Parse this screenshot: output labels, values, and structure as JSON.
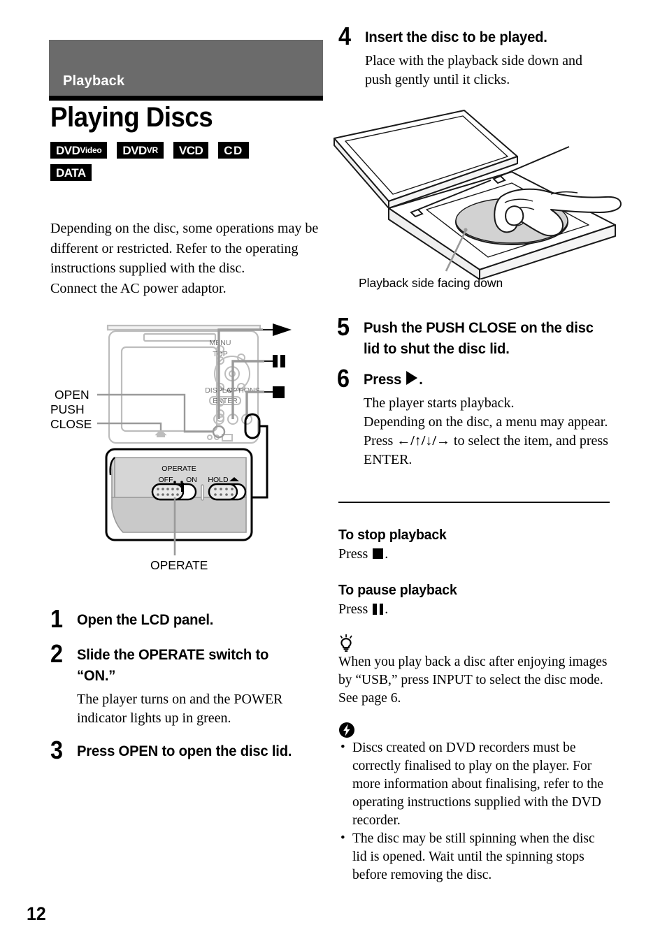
{
  "chapter": {
    "label": "Playback"
  },
  "title": "Playing Discs",
  "badges": [
    [
      {
        "main": "DVD",
        "sub": "Video",
        "name": "dvd-video"
      },
      {
        "main": "DVD",
        "sub": "VR",
        "name": "dvd-vr"
      },
      {
        "main": "VCD",
        "sub": "",
        "name": "vcd"
      },
      {
        "main": "CD",
        "sub": "",
        "name": "cd"
      }
    ],
    [
      {
        "main": "DATA",
        "sub": "",
        "name": "data"
      }
    ]
  ],
  "intro": {
    "p1": "Depending on the disc, some operations may be different or restricted. Refer to the operating instructions supplied with the disc.",
    "p2": "Connect the AC power adaptor."
  },
  "device_diagram": {
    "label_open": "OPEN",
    "label_push": "PUSH",
    "label_close": "CLOSE",
    "label_operate": "OPERATE",
    "switch_operate": "OPERATE",
    "switch_off": "OFF",
    "switch_on": "ON",
    "switch_hold": "HOLD"
  },
  "steps": [
    {
      "num": "1",
      "head": "Open the LCD panel.",
      "desc": ""
    },
    {
      "num": "2",
      "head": "Slide the OPERATE switch to “ON.”",
      "desc": "The player turns on and the POWER indicator lights up in green."
    },
    {
      "num": "3",
      "head": "Press OPEN to open the disc lid.",
      "desc": ""
    },
    {
      "num": "4",
      "head": "Insert the disc to be played.",
      "desc": "Place with the playback side down and push gently until it clicks."
    },
    {
      "num": "5",
      "head": "Push the PUSH CLOSE on the disc lid to shut the disc lid.",
      "desc": ""
    },
    {
      "num": "6",
      "head_pre": "Press ",
      "head_post": ".",
      "desc_l1": "The player starts playback.",
      "desc_l2": "Depending on the disc, a menu may appear. Press ",
      "desc_arrows": "←/↑/↓/→",
      "desc_l3": " to select the item, and press ENTER."
    }
  ],
  "player_illustration": {
    "caption": "Playback side facing down"
  },
  "subsections": [
    {
      "head": "To stop playback",
      "pre": "Press ",
      "post": "."
    },
    {
      "head": "To pause playback",
      "pre": "Press ",
      "post": "."
    }
  ],
  "tip": {
    "icon": "lightbulb-icon",
    "text": "When you play back a disc after enjoying images by “USB,” press INPUT to select the disc mode. See page 6."
  },
  "notes": {
    "icon": "note-bolt-icon",
    "items": [
      "Discs created on DVD recorders must be correctly finalised to play on the player. For more information about finalising, refer to the operating instructions supplied with the DVD recorder.",
      "The disc may be still spinning when the disc lid is opened. Wait until the spinning stops before removing the disc."
    ]
  },
  "page_number": "12",
  "colors": {
    "chapter_bar": "#6b6b6b",
    "badge_bg": "#000000",
    "text": "#000000"
  }
}
